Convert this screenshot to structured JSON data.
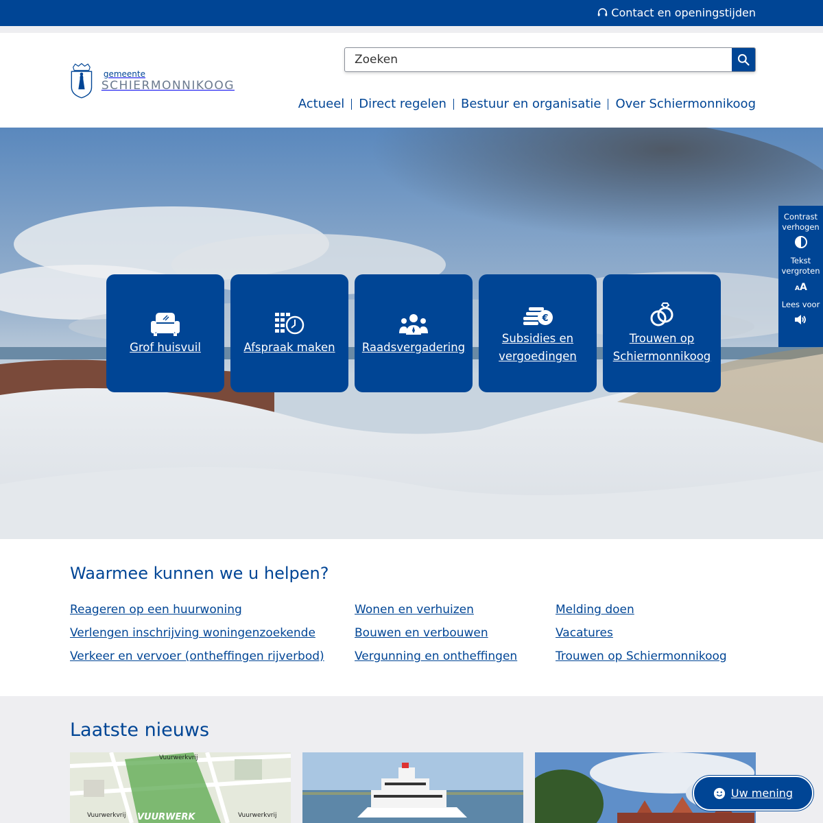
{
  "topbar": {
    "contact_label": "Contact en openingstijden"
  },
  "logo": {
    "small": "gemeente",
    "big": "SCHIERMONNIKOOG"
  },
  "search": {
    "placeholder": "Zoeken"
  },
  "nav": {
    "items": [
      "Actueel",
      "Direct regelen",
      "Bestuur en organisatie",
      "Over Schiermonnikoog"
    ]
  },
  "tiles": [
    {
      "label": "Grof huisvuil",
      "icon": "armchair-icon"
    },
    {
      "label": "Afspraak maken",
      "icon": "calendar-clock-icon"
    },
    {
      "label": "Raadsvergadering",
      "icon": "council-people-icon"
    },
    {
      "label": "Subsidies en vergoedingen",
      "icon": "coins-euro-icon"
    },
    {
      "label": "Trouwen op Schiermonnikoog",
      "icon": "wedding-rings-icon"
    }
  ],
  "a11y": {
    "contrast": "Contrast verhogen",
    "text": "Tekst vergroten",
    "read": "Lees voor"
  },
  "help": {
    "title": "Waarmee kunnen we u helpen?",
    "col1": [
      "Reageren op een huurwoning",
      "Verlengen inschrijving woningenzoekende",
      "Verkeer en vervoer (ontheffingen rijverbod)"
    ],
    "col2": [
      "Wonen en verhuizen",
      "Bouwen en verbouwen",
      "Vergunning en ontheffingen"
    ],
    "col3": [
      "Melding doen",
      "Vacatures",
      "Trouwen op Schiermonnikoog"
    ]
  },
  "news": {
    "title": "Laatste nieuws",
    "map_labels": [
      "Vuurwerkvrij",
      "Vuurwerkvrij",
      "Vuurwerkvrij",
      "VUURWERK"
    ]
  },
  "feedback": {
    "label": "Uw mening"
  },
  "colors": {
    "brand": "#004595",
    "light_bg": "#eeeef1"
  }
}
